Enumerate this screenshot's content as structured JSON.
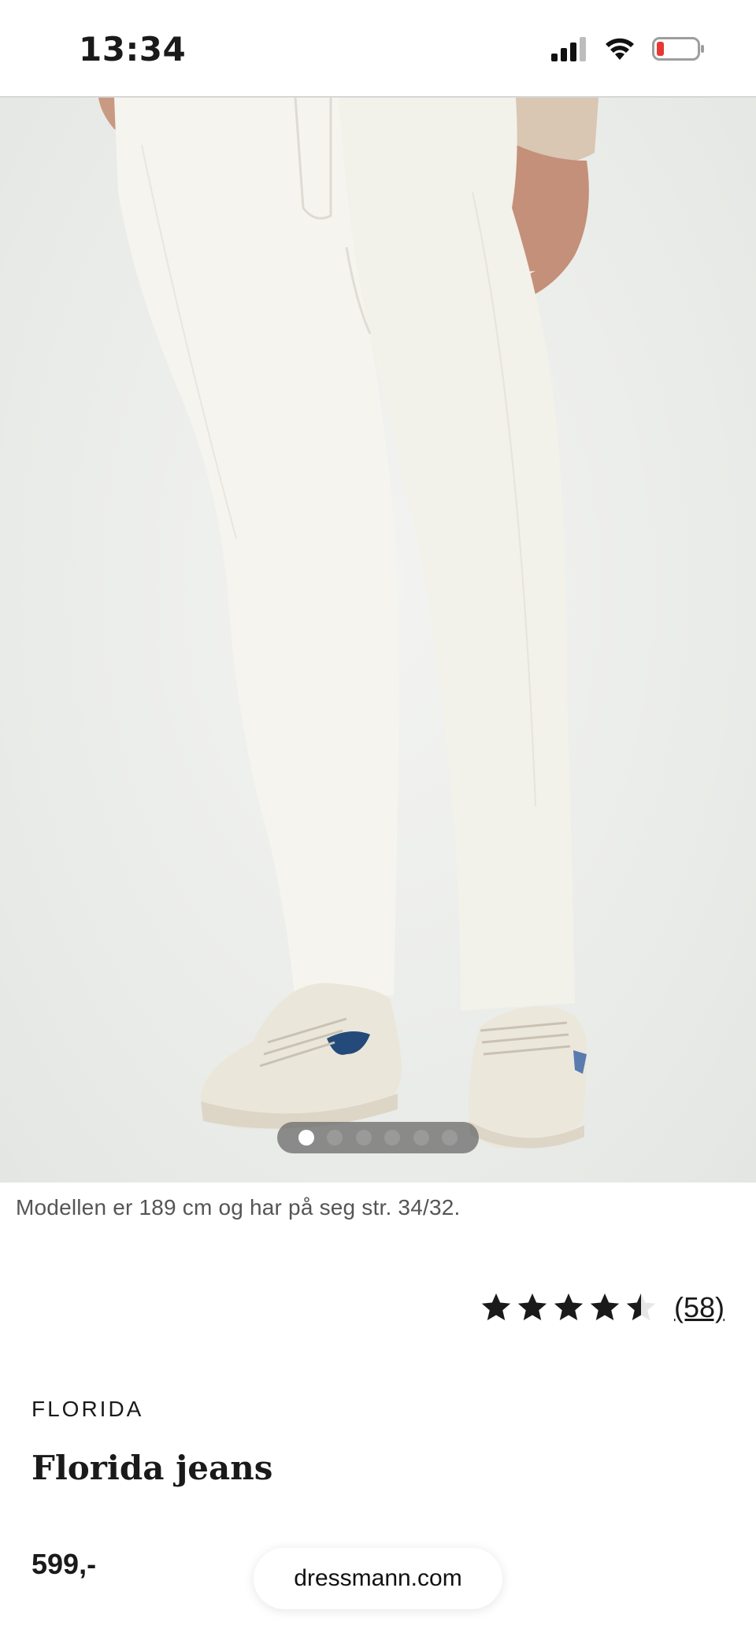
{
  "status_bar": {
    "time": "13:34",
    "icons": [
      "cellular-signal-icon",
      "wifi-icon",
      "battery-low-icon"
    ],
    "battery_color": "#e53935"
  },
  "gallery": {
    "image": "model-wearing-white-jeans-photo",
    "slide_count": 6,
    "active_slide": 1
  },
  "product": {
    "model_note": "Modellen er 189 cm og har på seg str. 34/32.",
    "rating": 4.5,
    "review_count": "(58)",
    "brand": "FLORIDA",
    "name": "Florida jeans",
    "price": "599,-"
  },
  "browser": {
    "url": "dressmann.com"
  }
}
